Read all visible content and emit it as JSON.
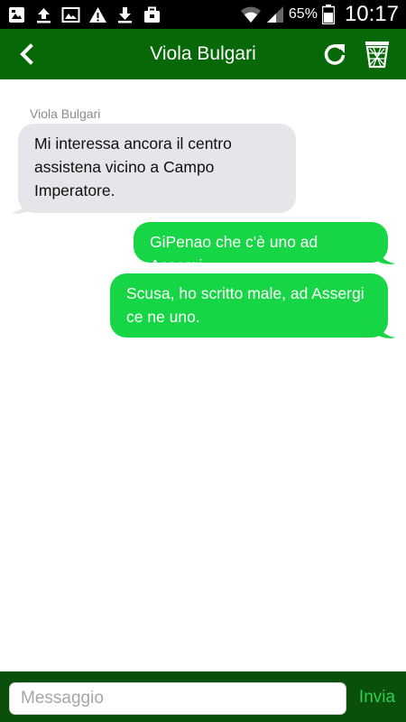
{
  "status_bar": {
    "icons_left": [
      "photo-sync-icon",
      "upload-icon",
      "image-icon",
      "warning-icon",
      "download-icon",
      "briefcase-icon"
    ],
    "battery_percent": "65%",
    "time": "10:17"
  },
  "app_bar": {
    "title": "Viola Bulgari",
    "back_icon": "chevron-left-icon",
    "refresh_icon": "refresh-icon",
    "delete_icon": "trash-icon"
  },
  "chat": {
    "messages": [
      {
        "direction": "incoming",
        "sender": "Viola Bulgari",
        "text": "Mi interessa ancora il centro assistena vicino a Campo Imperatore."
      },
      {
        "direction": "outgoing",
        "text": "GiPenao che c'è uno ad Assergi"
      },
      {
        "direction": "outgoing",
        "text": "Scusa, ho scritto male, ad Assergi ce ne uno."
      }
    ]
  },
  "composer": {
    "placeholder": "Messaggio",
    "send_label": "Invia"
  },
  "colors": {
    "app_bar": "#066806",
    "composer_bar": "#0a4f0a",
    "incoming_bubble": "#e5e5ea",
    "outgoing_bubble": "#16d645",
    "send_text": "#2ecf55"
  }
}
